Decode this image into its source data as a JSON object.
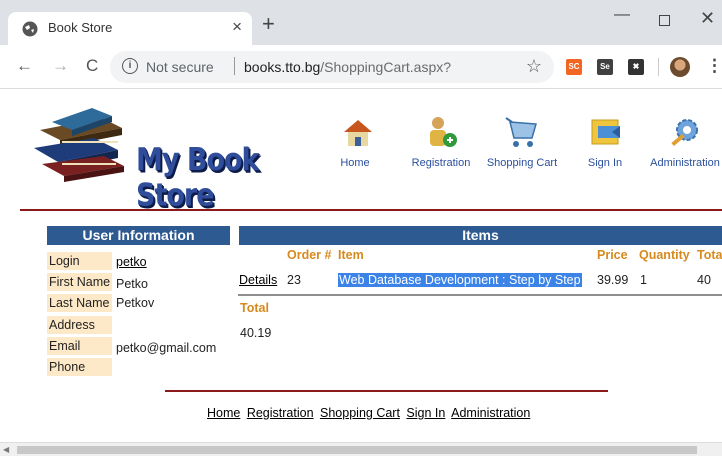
{
  "browser": {
    "tab_title": "Book Store",
    "tab_close": "×",
    "new_tab": "+",
    "back": "←",
    "forward": "→",
    "reload": "C",
    "info": "i",
    "security": "Not secure",
    "url_host": "books.tto.bg",
    "url_path": "/ShoppingCart.aspx?",
    "bookmark": "☆",
    "extensions": [
      {
        "label": "SC",
        "color": "#f26522"
      },
      {
        "label": "Se",
        "color": "#404040"
      },
      {
        "label": "✖",
        "color": "#333333"
      }
    ],
    "menu": "⋮",
    "win_minimize": "—",
    "win_close": "✕"
  },
  "site": {
    "logo_text": "My Book Store",
    "nav": [
      {
        "label": "Home",
        "icon": "home-icon"
      },
      {
        "label": "Registration",
        "icon": "registration-icon"
      },
      {
        "label": "Shopping Cart",
        "icon": "shopping-cart-icon"
      },
      {
        "label": "Sign In",
        "icon": "sign-in-icon"
      },
      {
        "label": "Administration",
        "icon": "administration-icon"
      }
    ],
    "colors": {
      "header_blue": "#2d5a91",
      "label_bg": "#fde9c7",
      "accent_orange": "#d68a1e",
      "rule_red": "#8b1a1a",
      "highlight": "#3b83e6"
    }
  },
  "user_info": {
    "title": "User Information",
    "rows": [
      {
        "label": "Login",
        "value": "petko"
      },
      {
        "label": "First Name",
        "value": "Petko"
      },
      {
        "label": "Last Name",
        "value": "Petkov"
      },
      {
        "label": "Address",
        "value": ""
      },
      {
        "label": "Email",
        "value": "petko@gmail.com"
      },
      {
        "label": "Phone",
        "value": ""
      }
    ]
  },
  "items": {
    "title": "Items",
    "columns": [
      "Order #",
      "Item",
      "Price",
      "Quantity",
      "Tota"
    ],
    "rows": [
      {
        "action": "Details",
        "order": "23",
        "item": "Web Database Development : Step by Step",
        "price": "39.99",
        "quantity": "1",
        "total": "40"
      }
    ],
    "total_label": "Total",
    "total_value": "40.19"
  },
  "footer": {
    "links": [
      "Home",
      "Registration",
      "Shopping Cart",
      "Sign In",
      "Administration"
    ]
  }
}
